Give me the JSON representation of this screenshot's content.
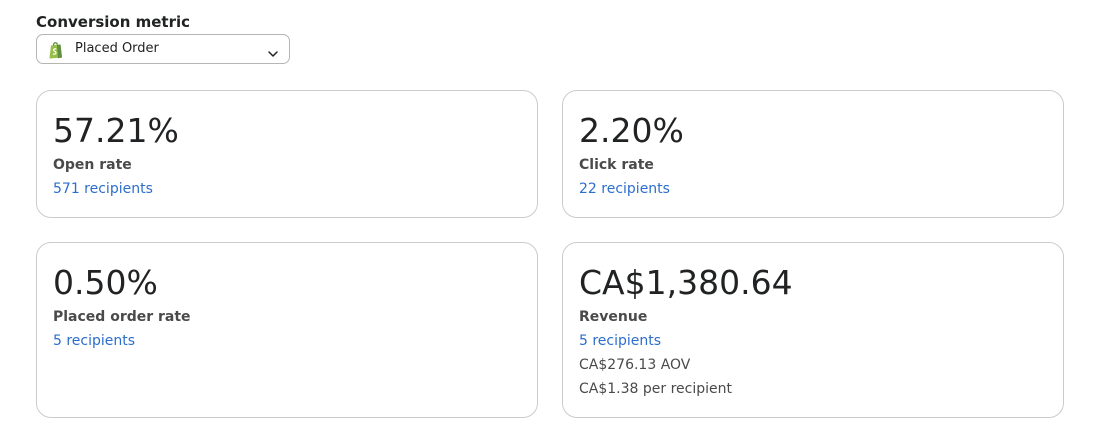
{
  "conversion_metric": {
    "label": "Conversion metric",
    "selected": "Placed Order",
    "icon": "shopify-bag-icon"
  },
  "cards": {
    "open_rate": {
      "value": "57.21%",
      "label": "Open rate",
      "recipients": "571 recipients"
    },
    "click_rate": {
      "value": "2.20%",
      "label": "Click rate",
      "recipients": "22 recipients"
    },
    "placed_order_rate": {
      "value": "0.50%",
      "label": "Placed order rate",
      "recipients": "5 recipients"
    },
    "revenue": {
      "value": "CA$1,380.64",
      "label": "Revenue",
      "recipients": "5 recipients",
      "aov": "CA$276.13 AOV",
      "per_recipient": "CA$1.38 per recipient"
    }
  },
  "colors": {
    "link": "#2c6ecb",
    "border": "#c9cccf",
    "shopify_green": "#95bf47",
    "text": "#202223"
  }
}
